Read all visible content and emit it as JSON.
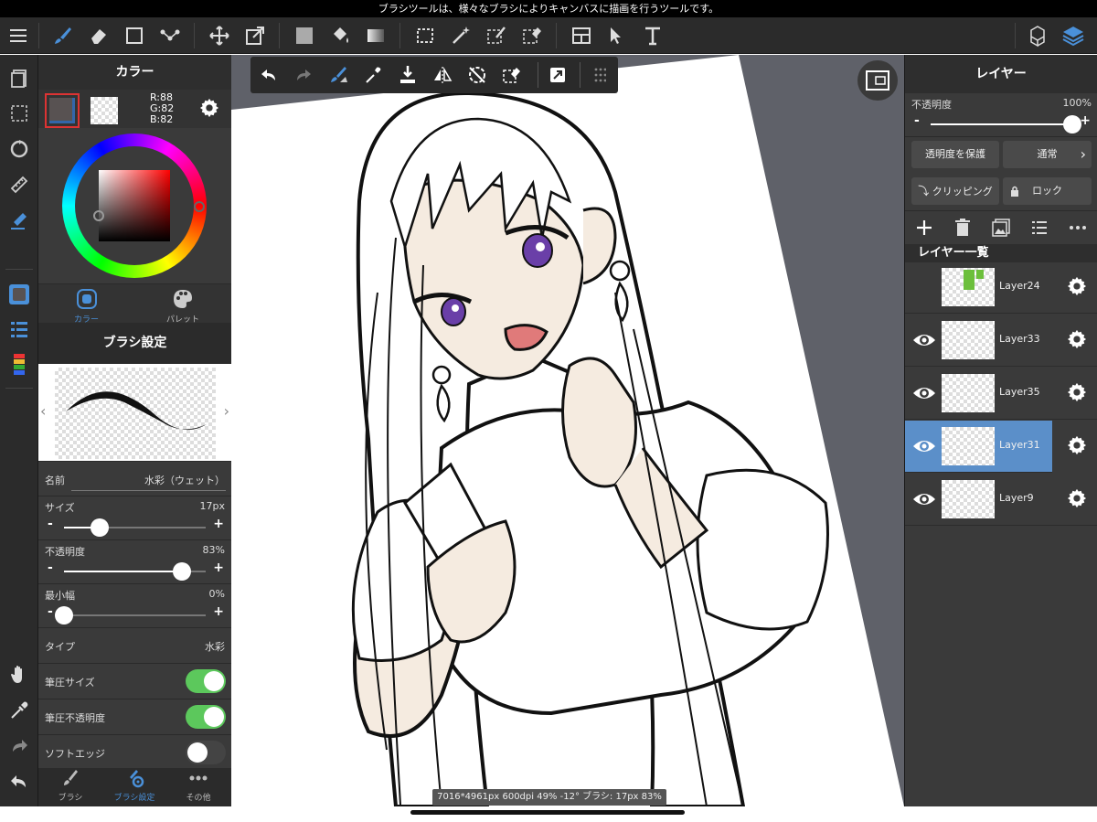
{
  "status_message": "ブラシツールは、様々なブラシによりキャンバスに描画を行うツールです。",
  "color_panel": {
    "title": "カラー",
    "r": "R:88",
    "g": "G:82",
    "b": "B:82",
    "main_color": "#585252",
    "tabs": [
      "カラー",
      "パレット"
    ]
  },
  "brush_panel": {
    "title": "ブラシ設定",
    "name_label": "名前",
    "name_value": "水彩（ウェット）",
    "size_label": "サイズ",
    "size_value": "17px",
    "size_level": 0.25,
    "opacity_label": "不透明度",
    "opacity_value": "83%",
    "opacity_level": 0.83,
    "minwidth_label": "最小幅",
    "minwidth_value": "0%",
    "minwidth_level": 0,
    "type_label": "タイプ",
    "type_value": "水彩",
    "pressure_size_label": "筆圧サイズ",
    "pressure_size_on": true,
    "pressure_opacity_label": "筆圧不透明度",
    "pressure_opacity_on": true,
    "soft_edge_label": "ソフトエッジ",
    "soft_edge_on": false
  },
  "bottom_tabs": [
    "ブラシ",
    "ブラシ設定",
    "その他"
  ],
  "info_bar": "7016*4961px 600dpi 49% -12° ブラシ: 17px 83%",
  "layer_panel": {
    "title": "レイヤー",
    "opacity_label": "不透明度",
    "opacity_value": "100%",
    "opacity_level": 1.0,
    "protect_alpha": "透明度を保護",
    "blend_mode": "通常",
    "clipping": "クリッピング",
    "lock": "ロック",
    "list_title": "レイヤー一覧",
    "layers": [
      {
        "name": "Layer24",
        "visible": false,
        "selected": false
      },
      {
        "name": "Layer33",
        "visible": true,
        "selected": false
      },
      {
        "name": "Layer35",
        "visible": true,
        "selected": false
      },
      {
        "name": "Layer31",
        "visible": true,
        "selected": true
      },
      {
        "name": "Layer9",
        "visible": true,
        "selected": false
      }
    ]
  },
  "colors": {
    "accent": "#4a90d9",
    "toggle_on": "#5cc85c",
    "selected_layer": "#5b8fc9",
    "skin": "#f5ebe0",
    "iris": "#6a3fa8",
    "mouth": "#e07a7a"
  }
}
